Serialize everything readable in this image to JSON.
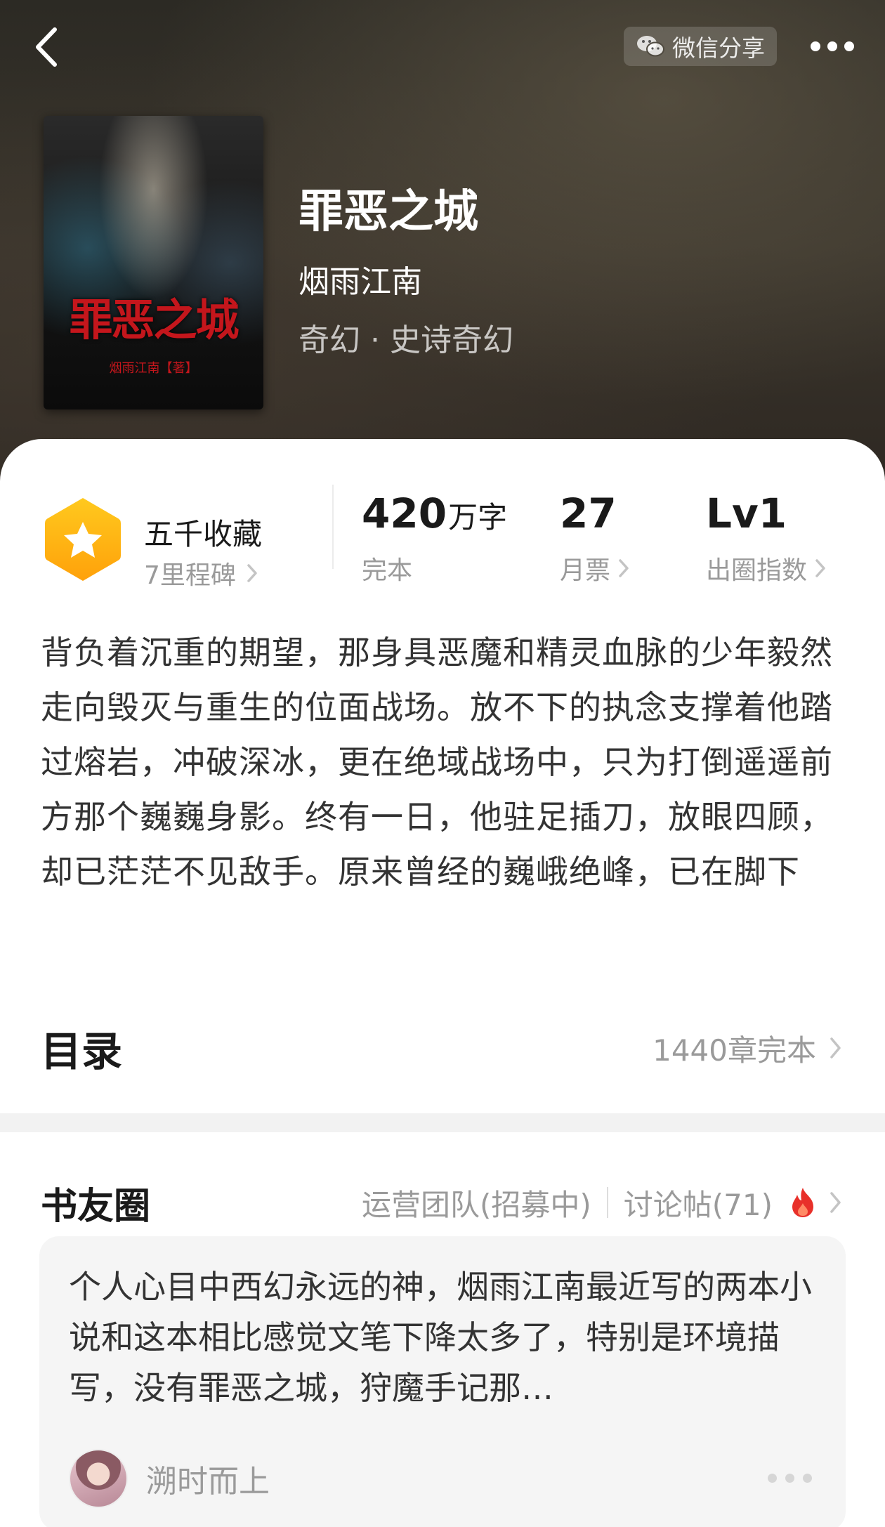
{
  "header": {
    "share_label": "微信分享"
  },
  "book": {
    "cover_title": "罪恶之城",
    "cover_author": "烟雨江南【著】",
    "title": "罪恶之城",
    "author": "烟雨江南",
    "genre": "奇幻 · 史诗奇幻"
  },
  "stats": {
    "collect_name": "五千收藏",
    "collect_sub": "7里程碑",
    "words_value": "420",
    "words_unit": "万字",
    "words_label": "完本",
    "tickets_value": "27",
    "tickets_label": "月票",
    "level_value": "Lv1",
    "level_label": "出圈指数"
  },
  "synopsis": "背负着沉重的期望，那身具恶魔和精灵血脉的少年毅然走向毁灭与重生的位面战场。放不下的执念支撑着他踏过熔岩，冲破深冰，更在绝域战场中，只为打倒遥遥前方那个巍巍身影。终有一日，他驻足插刀，放眼四顾，却已茫茫不见敌手。原来曾经的巍峨绝峰，已在脚下",
  "toc": {
    "title": "目录",
    "info": "1440章完本"
  },
  "community": {
    "title": "书友圈",
    "ops_link": "运营团队(招募中)",
    "posts_link": "讨论帖(71)",
    "post": {
      "text": "个人心目中西幻永远的神，烟雨江南最近写的两本小说和这本相比感觉文笔下降太多了，特别是环境描写，没有罪恶之城，狩魔手记那…",
      "user": "溯时而上"
    }
  },
  "colors": {
    "accent_orange": "#ffb400",
    "flame_red": "#e8302a"
  }
}
